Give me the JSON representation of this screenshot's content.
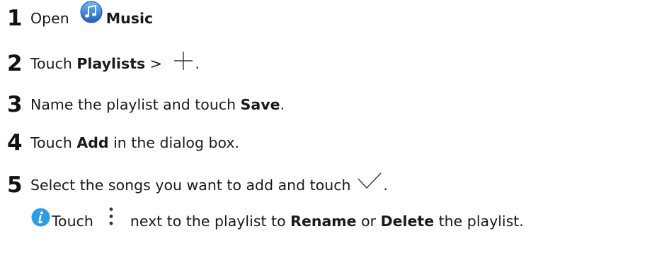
{
  "steps": [
    {
      "num": "1",
      "pre": "Open",
      "bold": "Music",
      "icon": "music-app-icon"
    },
    {
      "num": "2",
      "pre": "Touch ",
      "bold": "Playlists",
      "post": " > ",
      "end": ".",
      "icon": "plus-icon"
    },
    {
      "num": "3",
      "pre": "Name the playlist and touch ",
      "bold": "Save",
      "post": "."
    },
    {
      "num": "4",
      "pre": "Touch ",
      "bold": "Add",
      "post": " in the dialog box."
    },
    {
      "num": "5",
      "pre": "Select the songs you want to add and touch",
      "end": ".",
      "icon": "checkmark-icon"
    }
  ],
  "note": {
    "icon": "info-icon",
    "pre": "Touch",
    "dots_icon": "more-options-icon",
    "mid": "next to the playlist to ",
    "bold1": "Rename",
    "or": " or ",
    "bold2": "Delete",
    "post": " the playlist."
  },
  "colors": {
    "text": "#1a1a1a",
    "info_icon_bg": "#2f9be3",
    "music_icon_bg": "#2a7fd8"
  }
}
